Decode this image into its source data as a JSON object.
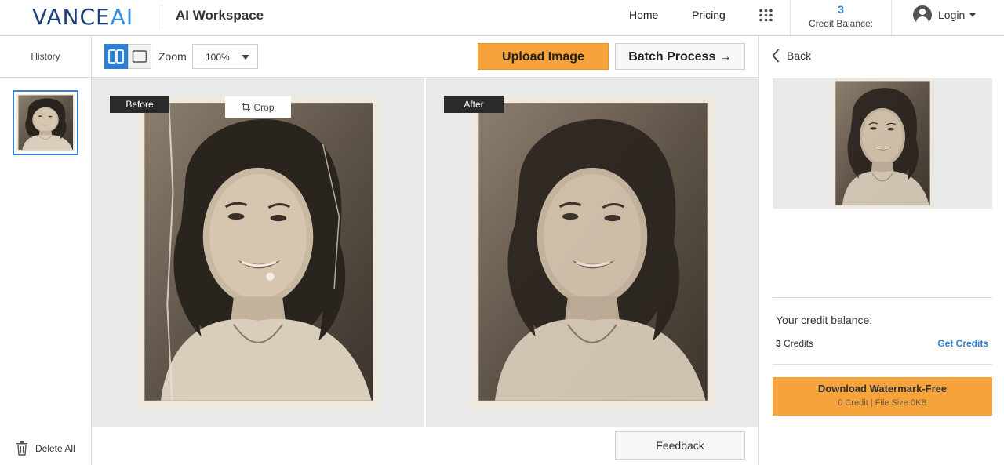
{
  "header": {
    "logo_main": "VANCE",
    "logo_ai": "AI",
    "workspace_title": "AI Workspace",
    "nav": {
      "home": "Home",
      "pricing": "Pricing"
    },
    "credit_count": "3",
    "credit_label": "Credit Balance:",
    "login": "Login"
  },
  "sidebar": {
    "history_label": "History",
    "delete_all": "Delete All"
  },
  "toolbar": {
    "zoom_label": "Zoom",
    "zoom_value": "100%",
    "upload_label": "Upload Image",
    "batch_label": "Batch Process →"
  },
  "compare": {
    "before_label": "Before",
    "after_label": "After",
    "crop_label": "Crop",
    "feedback_label": "Feedback"
  },
  "right_panel": {
    "back_label": "Back",
    "credit_title": "Your credit balance:",
    "credits_count": "3",
    "credits_suffix": "Credits",
    "get_credits": "Get Credits",
    "download_title": "Download Watermark-Free",
    "download_sub": "0 Credit | File Size:0KB"
  },
  "colors": {
    "accent_blue": "#2f7fd0",
    "accent_orange": "#f5a33a",
    "logo_navy": "#1f3f7a"
  }
}
